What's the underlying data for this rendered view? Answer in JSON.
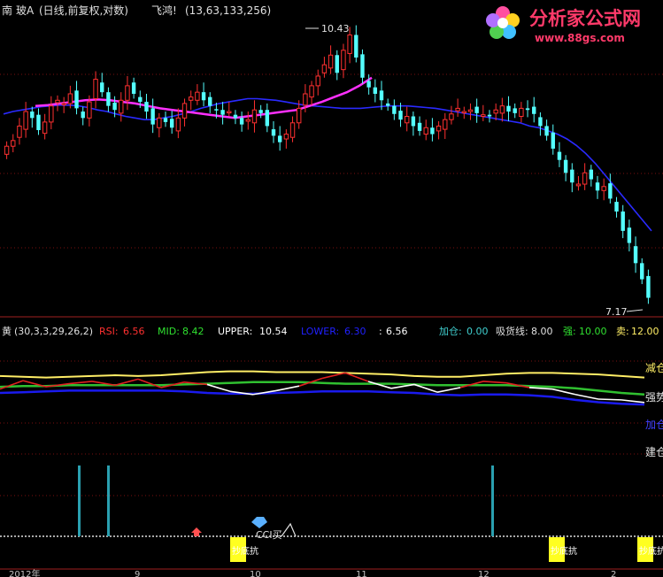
{
  "header": {
    "stock_prefix": "南",
    "stock_name": "玻A",
    "mode": "(日线,前复权,对数)",
    "indicator_name": "飞鸿!",
    "params": "(13,63,133,256)"
  },
  "watermark": {
    "brand": "分析家公式网",
    "url": "www.88gs.com"
  },
  "price_labels": {
    "high": "10.43",
    "low": "7.17"
  },
  "indicator_bar": {
    "name": "黄",
    "params": "(30,3,3,29,26,2)",
    "rsi_label": "RSI:",
    "rsi_value": "6.56",
    "mid_label": "MID:",
    "mid_value": "8.42",
    "upper_label": "UPPER:",
    "upper_value": "10.54",
    "lower_label": "LOWER:",
    "lower_value": "6.30",
    "extra_label": ":",
    "extra_value": "6.56",
    "add_label": "加仓:",
    "add_value": "0.00",
    "absorb_label": "吸货线:",
    "absorb_value": "8.00",
    "strong_label": "强:",
    "strong_value": "10.00",
    "sell_label": "卖:",
    "sell_value": "12.00"
  },
  "right_labels": {
    "reduce": "减仓",
    "strong": "强势",
    "add": "加仓",
    "build": "建仓"
  },
  "signals": {
    "cci_buy": "CCI买",
    "deep_pit": "抄底抗"
  },
  "x_axis": {
    "year_label": "2012年",
    "ticks": [
      "9",
      "10",
      "11",
      "12",
      "2"
    ]
  },
  "colors": {
    "up": "#ff3030",
    "down": "#54ffff",
    "ma_blue": "#2a2aff",
    "ma_magenta": "#ff30ff",
    "rsi_white": "#ffffff",
    "rsi_red": "#e02020",
    "upper_yellow": "#ffee66",
    "mid_green": "#30c030",
    "lower_blue": "#1a1aee",
    "signal_teal": "#2aa0b0",
    "signal_yellow": "#ffff20"
  },
  "chart_data": {
    "type": "candlestick",
    "price_range": [
      7.0,
      10.6
    ],
    "closes": [
      9.05,
      9.12,
      9.3,
      9.48,
      9.4,
      9.25,
      9.35,
      9.55,
      9.62,
      9.58,
      9.7,
      9.52,
      9.4,
      9.6,
      9.88,
      9.72,
      9.55,
      9.5,
      9.62,
      9.8,
      9.7,
      9.6,
      9.48,
      9.32,
      9.4,
      9.35,
      9.28,
      9.4,
      9.58,
      9.66,
      9.72,
      9.62,
      9.55,
      9.5,
      9.44,
      9.48,
      9.4,
      9.32,
      9.38,
      9.5,
      9.46,
      9.3,
      9.18,
      9.1,
      9.2,
      9.34,
      9.52,
      9.7,
      9.8,
      9.92,
      10.06,
      10.18,
      9.96,
      10.24,
      10.43,
      10.15,
      9.9,
      9.78,
      9.7,
      9.62,
      9.55,
      9.45,
      9.38,
      9.42,
      9.3,
      9.24,
      9.28,
      9.2,
      9.3,
      9.38,
      9.45,
      9.52,
      9.48,
      9.5,
      9.46,
      9.44,
      9.42,
      9.5,
      9.55,
      9.48,
      9.46,
      9.52,
      9.5,
      9.45,
      9.3,
      9.18,
      9.02,
      8.88,
      8.72,
      8.6,
      8.58,
      8.72,
      8.64,
      8.5,
      8.55,
      8.4,
      8.24,
      8.0,
      7.85,
      7.6,
      7.4,
      7.17
    ],
    "overlay_series": [
      {
        "name": "",
        "color": "blue",
        "values": [
          9.45,
          9.48,
          9.5,
          9.52,
          9.54,
          9.55,
          9.56,
          9.56,
          9.55,
          9.53,
          9.5,
          9.48,
          9.45,
          9.42,
          9.4,
          9.38,
          9.38,
          9.4,
          9.42,
          9.45,
          9.48,
          9.52,
          9.55,
          9.58,
          9.6,
          9.62,
          9.64,
          9.64,
          9.63,
          9.62,
          9.6,
          9.58,
          9.56,
          9.55,
          9.54,
          9.53,
          9.52,
          9.52,
          9.52,
          9.53,
          9.54,
          9.55,
          9.55,
          9.55,
          9.54,
          9.53,
          9.52,
          9.5,
          9.48,
          9.46,
          9.44,
          9.42,
          9.4,
          9.38,
          9.36,
          9.34,
          9.3,
          9.28,
          9.24,
          9.2,
          9.14,
          9.06,
          8.96,
          8.84,
          8.7,
          8.56,
          8.42,
          8.28,
          8.14,
          8.0
        ]
      },
      {
        "name": "",
        "color": "magenta",
        "values": [
          9.55,
          9.56,
          9.58,
          9.6,
          9.62,
          9.63,
          9.62,
          9.6,
          9.58,
          9.55,
          9.52,
          9.5,
          9.48,
          9.46,
          9.44,
          9.42,
          9.4,
          9.42,
          9.44,
          9.46,
          9.48,
          9.5,
          9.55,
          9.6,
          9.66,
          9.72,
          9.8,
          9.9
        ]
      }
    ],
    "oscillator": {
      "range": [
        0,
        14
      ],
      "upper": [
        10.0,
        9.9,
        9.8,
        9.9,
        10.0,
        10.1,
        10.0,
        10.1,
        10.3,
        10.5,
        10.6,
        10.6,
        10.5,
        10.5,
        10.5,
        10.4,
        10.3,
        10.2,
        10.0,
        9.9,
        9.9,
        10.1,
        10.3,
        10.4,
        10.4,
        10.3,
        10.2,
        10.0,
        9.8
      ],
      "mid": [
        8.6,
        8.7,
        8.7,
        8.8,
        8.8,
        8.8,
        8.8,
        8.8,
        8.9,
        9.0,
        9.1,
        9.2,
        9.2,
        9.2,
        9.1,
        9.0,
        9.0,
        9.0,
        8.9,
        8.8,
        8.8,
        8.8,
        8.8,
        8.7,
        8.6,
        8.4,
        8.1,
        7.8,
        7.6
      ],
      "lower": [
        7.8,
        7.9,
        8.0,
        8.1,
        8.1,
        8.1,
        8.1,
        8.1,
        8.0,
        7.8,
        7.7,
        7.7,
        7.8,
        7.9,
        8.0,
        8.0,
        8.0,
        7.9,
        7.8,
        7.6,
        7.5,
        7.6,
        7.6,
        7.5,
        7.3,
        6.9,
        6.6,
        6.4,
        6.3
      ],
      "rsi": [
        8.3,
        9.4,
        8.6,
        9.0,
        9.3,
        8.8,
        9.6,
        8.5,
        9.2,
        8.9,
        8.0,
        7.6,
        8.1,
        8.7,
        9.7,
        10.4,
        9.3,
        8.4,
        8.9,
        7.9,
        8.5,
        9.3,
        9.1,
        8.5,
        8.3,
        7.6,
        7.0,
        6.9,
        6.56
      ],
      "levels": {
        "add": 0.0,
        "absorb": 8.0,
        "strong": 10.0,
        "sell": 12.0
      }
    }
  }
}
